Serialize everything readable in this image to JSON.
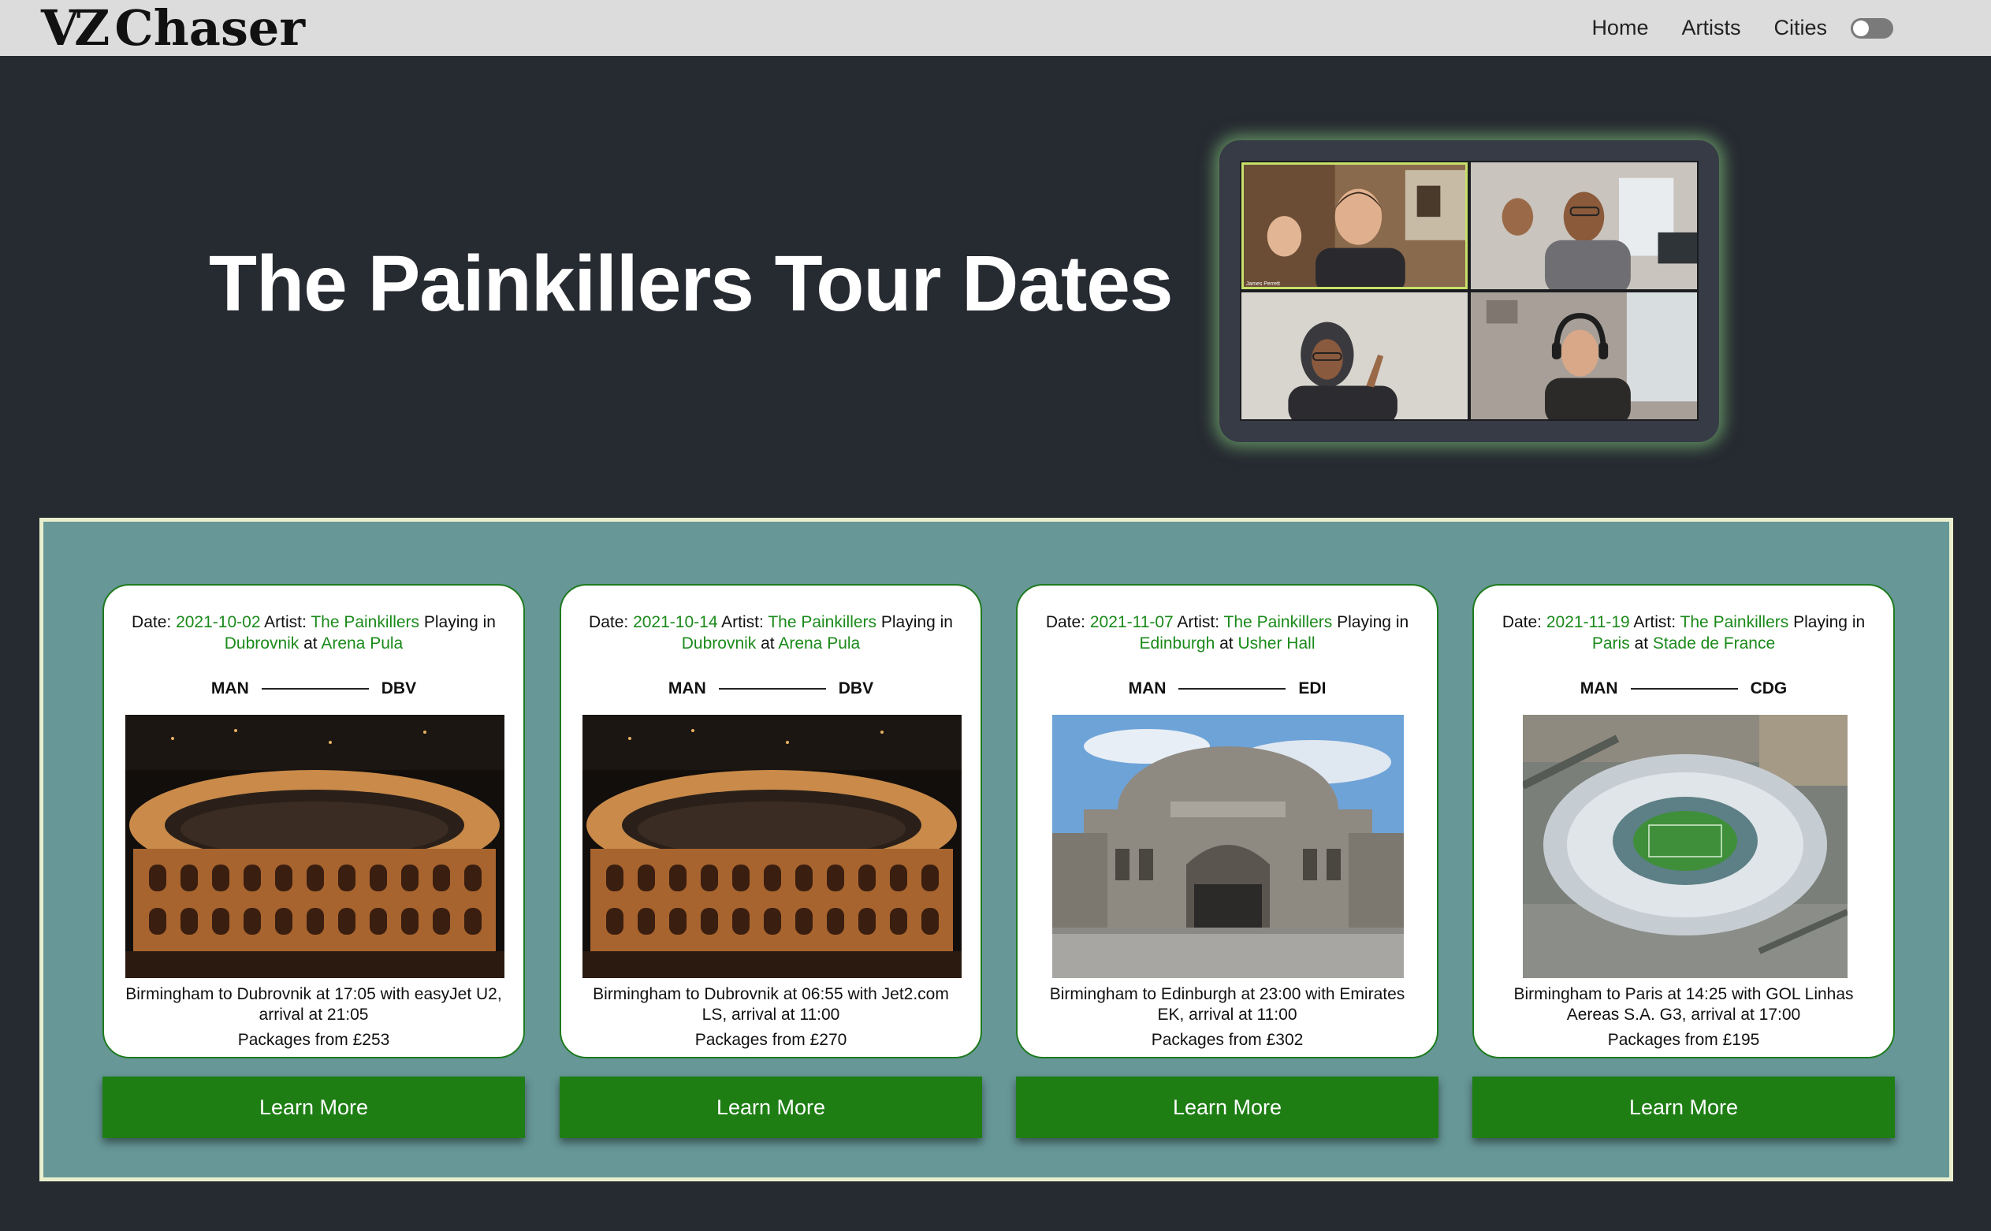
{
  "nav": {
    "logo_mark": "VZ",
    "logo_text": "Chaser",
    "links": [
      "Home",
      "Artists",
      "Cities"
    ],
    "dark_mode_toggle": "off"
  },
  "hero": {
    "title": "The Painkillers Tour Dates",
    "video_name_tag": "James Perrett"
  },
  "colors": {
    "nav_bg": "#dcdcdc",
    "page_bg": "#262a31",
    "panel_bg": "#679797",
    "accent_green": "#1a8a1a",
    "button_green": "#1e7e14"
  },
  "events": [
    {
      "date_label": "Date: ",
      "date": "2021-10-02",
      "artist_label": " Artist: ",
      "artist": "The Painkillers",
      "playing_label": " Playing in",
      "city": "Dubrovnik",
      "at_label": " at ",
      "venue": "Arena Pula",
      "from_code": "MAN",
      "to_code": "DBV",
      "flight": "Birmingham to Dubrovnik at 17:05 with easyJet U2, arrival at 21:05",
      "price": "Packages from £253",
      "button": "Learn More",
      "image": "amphitheatre-night"
    },
    {
      "date_label": "Date: ",
      "date": "2021-10-14",
      "artist_label": " Artist: ",
      "artist": "The Painkillers",
      "playing_label": " Playing in",
      "city": "Dubrovnik",
      "at_label": " at ",
      "venue": "Arena Pula",
      "from_code": "MAN",
      "to_code": "DBV",
      "flight": "Birmingham to Dubrovnik at 06:55 with Jet2.com LS, arrival at 11:00",
      "price": "Packages from £270",
      "button": "Learn More",
      "image": "amphitheatre-night"
    },
    {
      "date_label": "Date: ",
      "date": "2021-11-07",
      "artist_label": " Artist: ",
      "artist": "The Painkillers",
      "playing_label": " Playing in",
      "city": "Edinburgh",
      "at_label": " at ",
      "venue": "Usher Hall",
      "from_code": "MAN",
      "to_code": "EDI",
      "flight": "Birmingham to Edinburgh at 23:00 with Emirates EK, arrival at 11:00",
      "price": "Packages from £302",
      "button": "Learn More",
      "image": "concert-hall-day"
    },
    {
      "date_label": "Date: ",
      "date": "2021-11-19",
      "artist_label": " Artist: ",
      "artist": "The Painkillers",
      "playing_label": " Playing in",
      "city": "Paris",
      "at_label": " at ",
      "venue": "Stade de France",
      "from_code": "MAN",
      "to_code": "CDG",
      "flight": "Birmingham to Paris at 14:25 with GOL Linhas Aereas S.A. G3, arrival at 17:00",
      "price": "Packages from £195",
      "button": "Learn More",
      "image": "stadium-aerial"
    }
  ]
}
